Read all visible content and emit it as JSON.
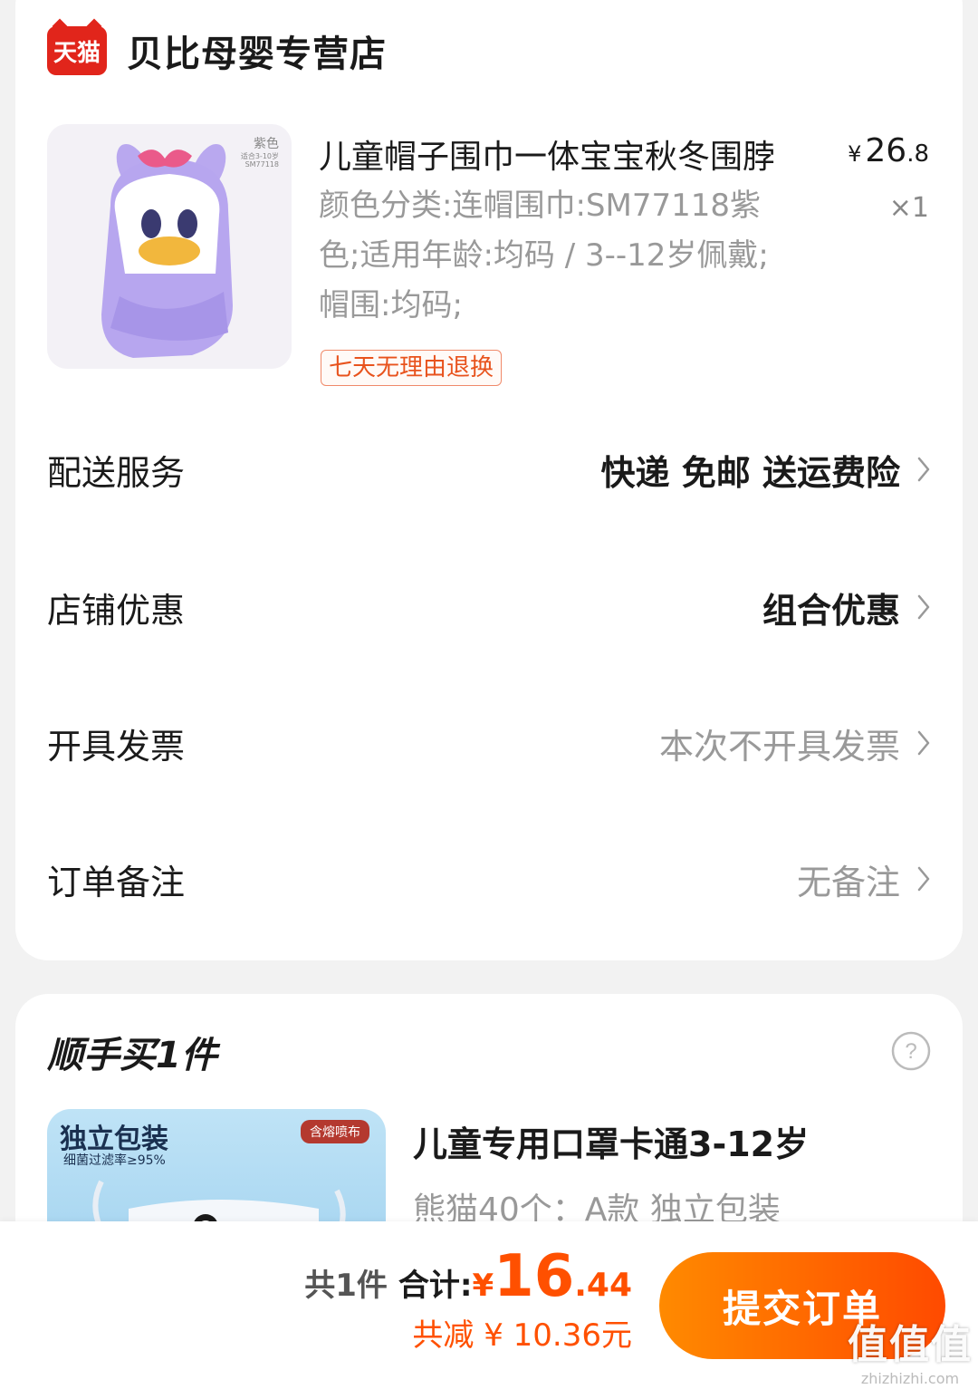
{
  "shop": {
    "badge": "天猫",
    "name": "贝比母婴专营店"
  },
  "product": {
    "title": "儿童帽子围巾一体宝宝秋冬围脖",
    "price_symbol": "¥",
    "price_int": "26",
    "price_dec": ".8",
    "quantity": "×1",
    "specs": "颜色分类:连帽围巾:SM77118紫色;适用年龄:均码 / 3--12岁佩戴;帽围:均码;",
    "image_tag_color": "紫色",
    "image_tag_age": "适合3-10岁",
    "image_tag_sku": "SM77118",
    "return_badge": "七天无理由退换"
  },
  "rows": {
    "delivery": {
      "label": "配送服务",
      "value": "快递 免邮 送运费险"
    },
    "discount": {
      "label": "店铺优惠",
      "value": "组合优惠"
    },
    "invoice": {
      "label": "开具发票",
      "value": "本次不开具发票"
    },
    "note": {
      "label": "订单备注",
      "value": "无备注"
    }
  },
  "addon": {
    "title": "顺手买1件",
    "name": "儿童专用口罩卡通3-12岁",
    "spec": "熊猫40个：A款 独立包装",
    "image_big": "独立包装",
    "image_small": "细菌过滤率≥95%",
    "image_corner": "含熔喷布"
  },
  "summary": {
    "count": "共1件",
    "label": "合计:",
    "symbol": "¥",
    "total_int": "16",
    "total_dec": ".44",
    "saving": "共减 ¥ 10.36元",
    "submit": "提交订单"
  },
  "watermark": {
    "logo": "值值值",
    "url": "zhizhizhi.com"
  },
  "colors": {
    "accent": "#ff5000",
    "tmall_red": "#e1251b",
    "badge_border": "#f08a6a"
  }
}
